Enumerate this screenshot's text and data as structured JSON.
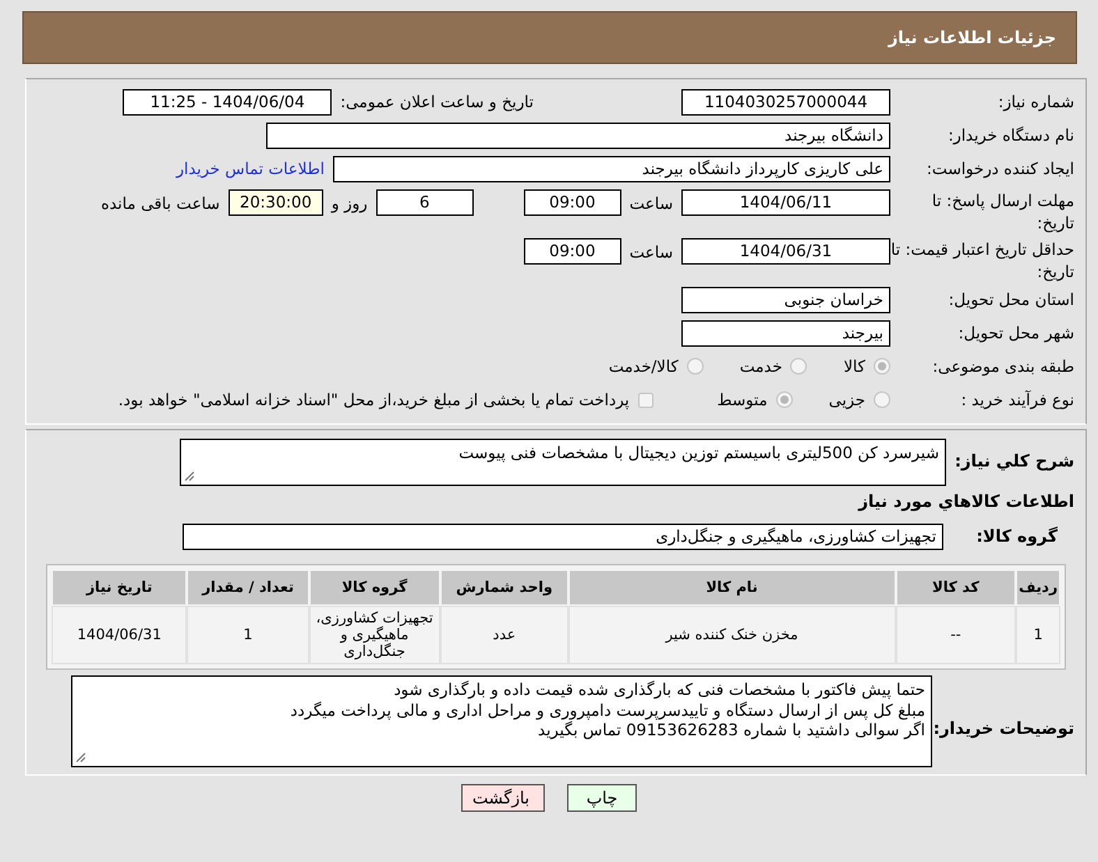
{
  "header": {
    "title": "جزئیات اطلاعات نیاز"
  },
  "need_number": {
    "label": "شماره نیاز:",
    "value": "1104030257000044"
  },
  "announce_datetime": {
    "label": "تاریخ و ساعت اعلان عمومی:",
    "value": "1404/06/04 - 11:25"
  },
  "buyer_org": {
    "label": "نام دستگاه خریدار:",
    "value": "دانشگاه بیرجند"
  },
  "requester": {
    "label": "ایجاد کننده درخواست:",
    "value": "علی کاریزی کارپرداز دانشگاه بیرجند",
    "contact_link": "اطلاعات تماس خریدار"
  },
  "reply_deadline": {
    "label": "مهلت ارسال پاسخ: تا تاریخ:",
    "date": "1404/06/11",
    "time_label": "ساعت",
    "time": "09:00",
    "days": "6",
    "days_label": "روز و",
    "remaining": "20:30:00",
    "remaining_label": "ساعت باقی مانده"
  },
  "price_validity": {
    "label": "حداقل تاریخ اعتبار قیمت: تا تاریخ:",
    "date": "1404/06/31",
    "time_label": "ساعت",
    "time": "09:00"
  },
  "province": {
    "label": "استان محل تحویل:",
    "value": "خراسان جنوبی"
  },
  "city": {
    "label": "شهر محل تحویل:",
    "value": "بیرجند"
  },
  "category": {
    "label": "طبقه بندی موضوعی:",
    "options": [
      {
        "label": "کالا",
        "selected": true
      },
      {
        "label": "خدمت",
        "selected": false
      },
      {
        "label": "کالا/خدمت",
        "selected": false
      }
    ]
  },
  "purchase_type": {
    "label": "نوع فرآیند خرید :",
    "options": [
      {
        "label": "جزیی",
        "selected": false
      },
      {
        "label": "متوسط",
        "selected": true
      }
    ],
    "treasury": {
      "label": "پرداخت تمام یا بخشی از مبلغ خرید،از محل \"اسناد خزانه اسلامی\" خواهد بود.",
      "checked": false
    }
  },
  "description": {
    "label": "شرح کلي نياز:",
    "value": "شیرسرد کن 500لیتری باسیستم توزین دیجیتال با مشخصات فنی پیوست"
  },
  "goods_heading": "اطلاعات كالاهاي مورد نياز",
  "goods_group": {
    "label": "گروه کالا:",
    "value": "تجهیزات کشاورزی، ماهیگیری و جنگل‌داری"
  },
  "table": {
    "columns": [
      "ردیف",
      "کد کالا",
      "نام کالا",
      "واحد شمارش",
      "گروه کالا",
      "تعداد / مقدار",
      "تاریخ نیاز"
    ],
    "rows": [
      [
        "1",
        "--",
        "مخزن خنک کننده شیر",
        "عدد",
        "تجهیزات کشاورزی، ماهیگیری و جنگل‌داری",
        "1",
        "1404/06/31"
      ]
    ]
  },
  "buyer_notes": {
    "label": "توضیحات خریدار:",
    "lines": [
      "حتما پیش فاکتور با مشخصات فنی که بارگذاری شده قیمت داده و بارگذاری شود",
      "مبلغ کل پس از ارسال دستگاه و تاییدسرپرست دامپروری و مراحل اداری و مالی پرداخت میگردد",
      "اگر سوالی داشتید با شماره 09153626283 تماس بگیرید"
    ]
  },
  "buttons": [
    {
      "label": "چاپ",
      "kind": "print"
    },
    {
      "label": "بازگشت",
      "kind": "back"
    }
  ]
}
